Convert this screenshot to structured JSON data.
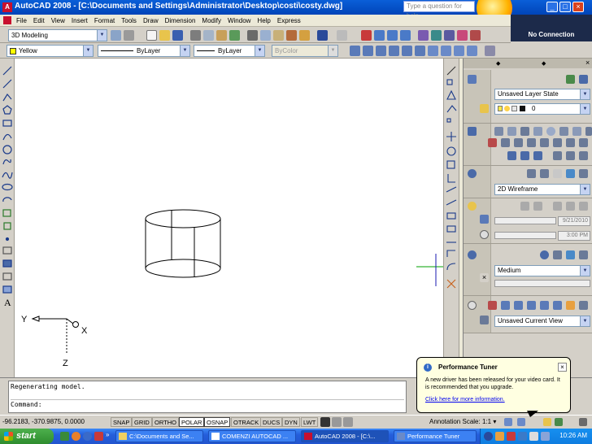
{
  "window": {
    "app_title": "AutoCAD 2008 - [C:\\Documents and Settings\\Administrator\\Desktop\\costi\\costy.dwg]",
    "help_placeholder": "Type a question for help",
    "no_connection": "No Connection"
  },
  "menu": [
    "File",
    "Edit",
    "View",
    "Insert",
    "Format",
    "Tools",
    "Draw",
    "Dimension",
    "Modify",
    "Window",
    "Help",
    "Express"
  ],
  "toolbar": {
    "workspace": "3D Modeling",
    "layer": "Yellow",
    "linetype": "ByLayer",
    "lineweight": "ByLayer",
    "plotstyle": "ByColor"
  },
  "ucs": {
    "x_label": "X",
    "y_label": "Y",
    "z_label": "Z"
  },
  "dashboard": {
    "layer_state": "Unsaved Layer State",
    "layer_number": "0",
    "visual_style": "2D Wireframe",
    "date": "9/21/2010",
    "time": "3:00 PM",
    "material_quality": "Medium",
    "view": "Unsaved Current View"
  },
  "command": {
    "history": "Regenerating model.",
    "prompt": "Command:"
  },
  "balloon": {
    "title": "Performance Tuner",
    "body": "A new driver has been released for your video card. It is recommended that you upgrade.",
    "link": "Click here for more information."
  },
  "status": {
    "coords": "-96.2183,  -370.9875, 0.0000",
    "buttons": [
      "SNAP",
      "GRID",
      "ORTHO",
      "POLAR",
      "OSNAP",
      "OTRACK",
      "DUCS",
      "DYN",
      "LWT"
    ],
    "annotation_scale_label": "Annotation Scale:",
    "annotation_scale_value": "1:1"
  },
  "taskbar": {
    "start": "start",
    "tasks": [
      "C:\\Documents and Se...",
      "COMENZI AUTOCAD ...",
      "AutoCAD 2008 - [C:\\...",
      "Performance Tuner"
    ],
    "clock": "10:26 AM"
  },
  "colors": {
    "titlebar": "#0a5fd8",
    "canvas": "#ffffff",
    "layer_yellow": "#ffff00",
    "crosshair": "#00a000",
    "taskbar": "#245edb",
    "start_green": "#2e8c2e"
  }
}
